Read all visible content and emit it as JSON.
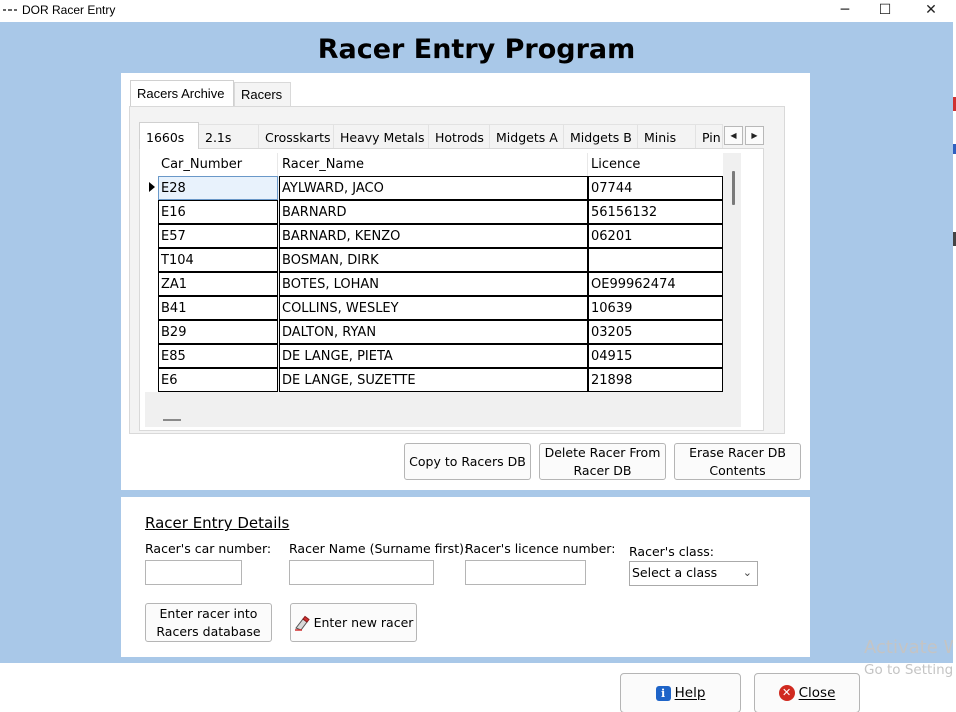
{
  "window": {
    "title": "DOR Racer Entry",
    "minimize_glyph": "─",
    "maximize_glyph": "☐",
    "close_glyph": "✕"
  },
  "heading": "Racer Entry Program",
  "outer_tabs": [
    "Racers Archive",
    "Racers"
  ],
  "inner_tabs": [
    "1660s",
    "2.1s",
    "Crosskarts",
    "Heavy Metals",
    "Hotrods",
    "Midgets A",
    "Midgets B",
    "Minis",
    "Pin"
  ],
  "tab_scroll": {
    "left": "◀",
    "right": "▶"
  },
  "grid": {
    "columns": [
      "Car_Number",
      "Racer_Name",
      "Licence"
    ],
    "rows": [
      [
        "E28",
        "AYLWARD, JACO",
        "07744"
      ],
      [
        "E16",
        "BARNARD",
        "56156132"
      ],
      [
        "E57",
        "BARNARD, KENZO",
        "06201"
      ],
      [
        "T104",
        "BOSMAN, DIRK",
        ""
      ],
      [
        "ZA1",
        "BOTES, LOHAN",
        "OE99962474"
      ],
      [
        "B41",
        "COLLINS, WESLEY",
        "10639"
      ],
      [
        "B29",
        "DALTON, RYAN",
        "03205"
      ],
      [
        "E85",
        "DE LANGE, PIETA",
        "04915"
      ],
      [
        "E6",
        "DE LANGE, SUZETTE",
        "21898"
      ]
    ]
  },
  "archive_buttons": {
    "copy": "Copy to Racers DB",
    "delete_line1": "Delete Racer From",
    "delete_line2": "Racer DB",
    "erase_line1": "Erase Racer DB",
    "erase_line2": "Contents"
  },
  "details": {
    "title": "Racer Entry Details",
    "car_label": "Racer's car number:",
    "name_label": "Racer Name (Surname first):",
    "licence_label": "Racer's licence number:",
    "class_label": "Racer's class:",
    "class_value": "Select a class",
    "enter_db_line1": "Enter racer into",
    "enter_db_line2": "Racers database",
    "enter_new": "Enter new racer"
  },
  "footer": {
    "help": "Help",
    "close": "Close"
  },
  "watermark": {
    "line1": "Activate W",
    "line2": "Go to Settings"
  },
  "colors": {
    "background": "#a9c8e8",
    "panel": "#ffffff",
    "selected_cell": "#e8f2fc"
  },
  "icons": {
    "help": "info-icon",
    "close": "close-circle-icon",
    "enter_new": "pencil-eraser-icon"
  }
}
